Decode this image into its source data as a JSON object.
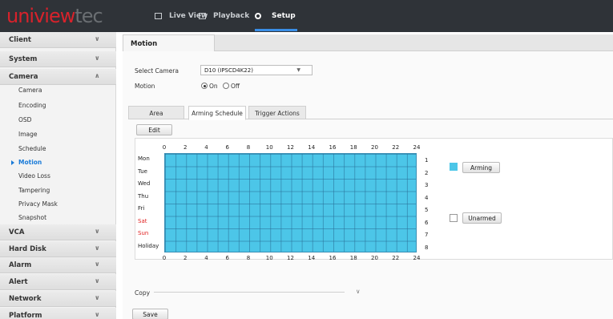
{
  "brand": {
    "logo_red": "uniview",
    "logo_gray": "tec"
  },
  "top_nav": {
    "live_view": "Live View",
    "playback": "Playback",
    "setup": "Setup"
  },
  "sidebar": {
    "client": "Client",
    "system": "System",
    "camera": "Camera",
    "camera_items": [
      "Camera",
      "Encoding",
      "OSD",
      "Image",
      "Schedule",
      "Motion",
      "Video Loss",
      "Tampering",
      "Privacy Mask",
      "Snapshot"
    ],
    "vca": "VCA",
    "hard_disk": "Hard Disk",
    "alarm": "Alarm",
    "alert": "Alert",
    "network": "Network",
    "platform": "Platform"
  },
  "page": {
    "tab": "Motion",
    "select_camera_label": "Select Camera",
    "select_camera_value": "D10 (IPSCD4K22)",
    "motion_label": "Motion",
    "motion_on": "On",
    "motion_off": "Off",
    "motion_value": "On"
  },
  "inner_tabs": [
    "Area",
    "Arming Schedule",
    "Trigger Actions"
  ],
  "inner_tab_active": "Arming Schedule",
  "edit_button": "Edit",
  "schedule": {
    "hour_ticks": [
      "0",
      "2",
      "4",
      "6",
      "8",
      "10",
      "12",
      "14",
      "16",
      "18",
      "20",
      "22",
      "24"
    ],
    "days": [
      "Mon",
      "Tue",
      "Wed",
      "Thu",
      "Fri",
      "Sat",
      "Sun",
      "Holiday"
    ],
    "row_numbers": [
      "1",
      "2",
      "3",
      "4",
      "5",
      "6",
      "7",
      "8"
    ],
    "armed_fraction": 1.0
  },
  "legend": {
    "arming": "Arming",
    "unarmed": "Unarmed"
  },
  "copy_label": "Copy",
  "save_button": "Save",
  "colors": {
    "armed": "#4cc6e8",
    "accent": "#1a7bd8",
    "weekend": "#e02020",
    "topbar": "#2f3338"
  }
}
